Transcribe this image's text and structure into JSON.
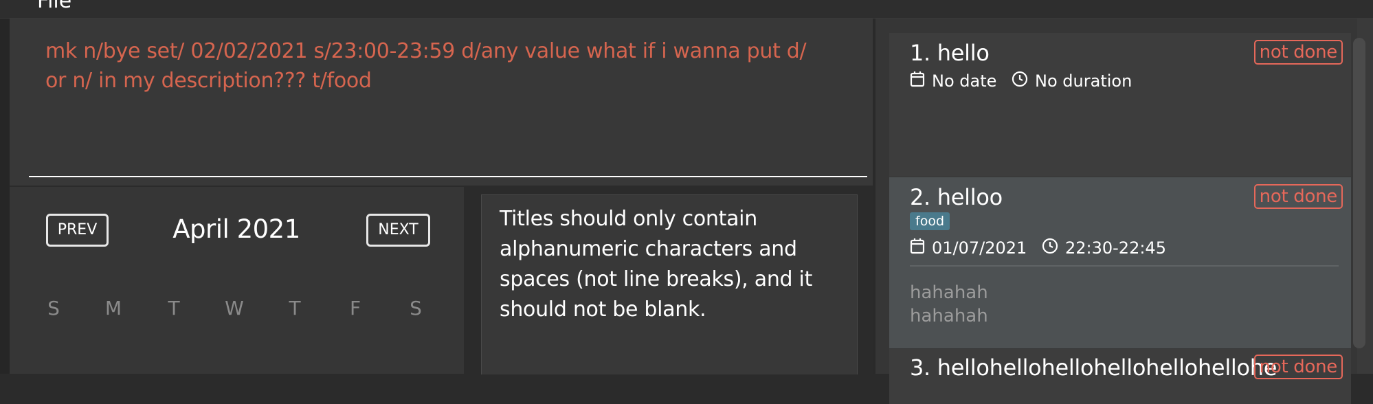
{
  "menu": {
    "file": "File"
  },
  "command": {
    "text": "mk n/bye  set/ 02/02/2021 s/23:00-23:59 d/any value what if i wanna put d/ or n/ in my description??? t/food"
  },
  "calendar": {
    "prev_label": "PREV",
    "month": "April 2021",
    "next_label": "NEXT",
    "days": [
      "S",
      "M",
      "T",
      "W",
      "T",
      "F",
      "S"
    ]
  },
  "result": {
    "message": "Titles should only contain alphanumeric characters and spaces (not line breaks), and it should not be blank."
  },
  "tasks": [
    {
      "title": "1.  hello",
      "status": "not done",
      "date": "No date",
      "duration": "No duration"
    },
    {
      "title": "2.  helloo",
      "status": "not done",
      "tag": "food",
      "date": "01/07/2021",
      "duration": "22:30-22:45",
      "description": [
        "hahahah",
        "hahahah"
      ]
    },
    {
      "title": "3.  hellohellohellohellohellohellohe",
      "status": "not done"
    }
  ],
  "colors": {
    "accent_red": "#d6654f",
    "status_red": "#e6685a",
    "tag_blue": "#4a7a8c",
    "selected_card": "#4d5153"
  },
  "icons": {
    "date": "calendar-icon",
    "duration": "clock-icon"
  }
}
